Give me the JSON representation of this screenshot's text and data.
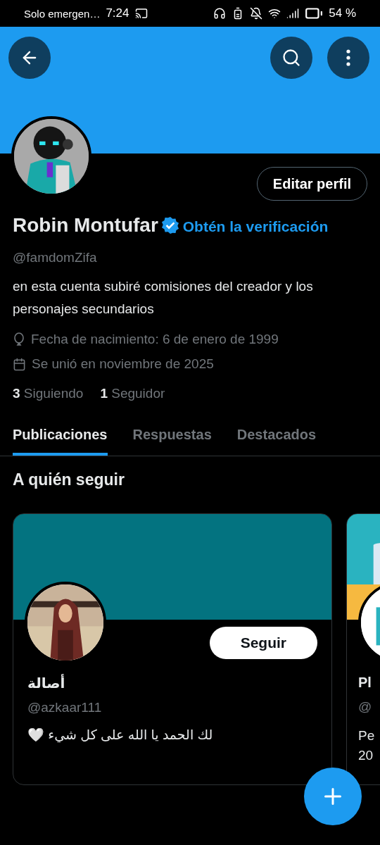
{
  "status_bar": {
    "carrier": "Solo emergen…",
    "time": "7:24",
    "battery": "54 %"
  },
  "profile": {
    "edit_button": "Editar perfil",
    "name": "Robin Montufar",
    "verified": true,
    "verify_link": "Obtén la verificación",
    "handle": "@famdomZifa",
    "bio": "en esta cuenta subiré comisiones del creador y los personajes secundarios",
    "details": [
      {
        "kind": "birthday",
        "text": "Fecha de nacimiento: 6 de enero de 1999"
      },
      {
        "kind": "joined",
        "text": "Se unió en noviembre de 2025"
      }
    ],
    "stats": [
      {
        "count": "3",
        "label": "Siguiendo"
      },
      {
        "count": "1",
        "label": "Seguidor"
      }
    ]
  },
  "tabs": [
    {
      "label": "Publicaciones",
      "selected": true
    },
    {
      "label": "Respuestas",
      "selected": false
    },
    {
      "label": "Destacados",
      "selected": false
    }
  ],
  "suggestions": {
    "title": "A quién seguir",
    "cards": [
      {
        "name": "أصالة",
        "handle": "@azkaar111",
        "bio": "لك الحمد يا الله على كل شيء 🤍",
        "button": "Seguir",
        "banner": {
          "kind": "plain"
        }
      },
      {
        "name": "Pl",
        "handle": "@",
        "bio": "Pe 20"
      }
    ]
  }
}
